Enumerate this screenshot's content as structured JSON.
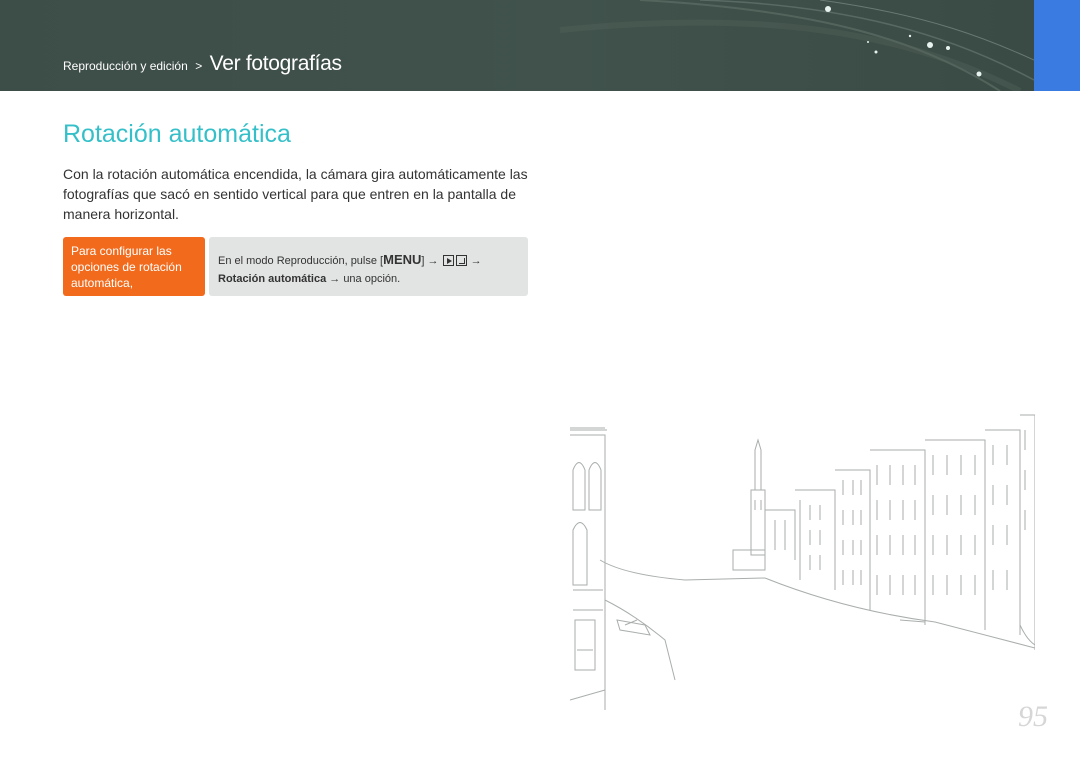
{
  "header": {
    "breadcrumb_section": "Reproducción y edición",
    "breadcrumb_separator": ">",
    "breadcrumb_page": "Ver fotografías",
    "background_color": "#3f4f49",
    "tab_color": "#3a7be2"
  },
  "title": "Rotación automática",
  "intro": "Con la rotación automática encendida, la cámara gira automáticamente las fotografías que sacó en sentido vertical para que entren en la pantalla de manera horizontal.",
  "howto": {
    "label": "Para configurar las opciones de rotación automática,",
    "step_prefix": "En el modo Reproducción, pulse [",
    "menu_key": "MENU",
    "step_close_bracket": "]",
    "arrow": "→",
    "play_icon": "playback-icon",
    "edit_icon": "edit-icon",
    "option_name": "Rotación automática",
    "step_suffix": "una opción."
  },
  "illustration": {
    "icon": "venice-canal-line-drawing"
  },
  "page_number": "95",
  "colors": {
    "title": "#35c0c9",
    "howto_label_bg": "#f26b1d",
    "howto_body_bg": "#e2e3e3"
  }
}
